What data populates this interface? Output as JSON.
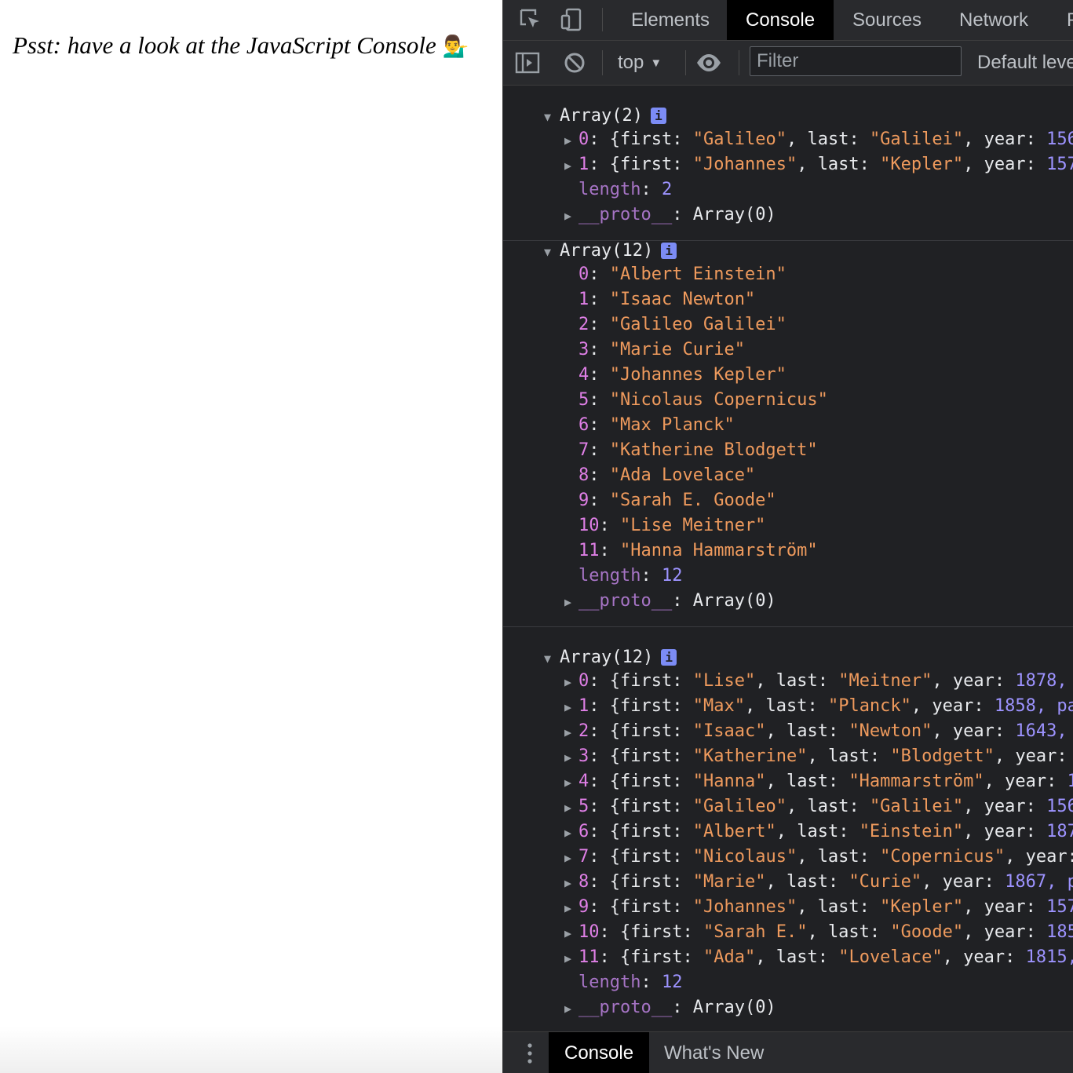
{
  "page": {
    "text": "Psst: have a look at the JavaScript Console",
    "emoji": "💁‍♂️"
  },
  "devtools": {
    "tabs": [
      "Elements",
      "Console",
      "Sources",
      "Network",
      "P"
    ],
    "active_tab": "Console",
    "toolbar": {
      "context": "top",
      "filter_placeholder": "Filter",
      "levels": "Default levels"
    },
    "drawer": {
      "tabs": [
        "Console",
        "What's New"
      ]
    },
    "icons": {
      "inspect": "inspect-element-icon",
      "device": "device-toggle-icon",
      "sidebar": "sidebar-toggle-icon",
      "clear": "clear-console-icon",
      "eye": "live-expression-icon",
      "kebab": "more-options-icon"
    },
    "colors": {
      "index": "#df7fe6",
      "string": "#ee9a5d",
      "number": "#9d93ff",
      "meta": "#a674c5"
    }
  },
  "console": {
    "messages": [
      {
        "header": "Array(2)",
        "rows": [
          {
            "kind": "obj",
            "idx": "0",
            "first": "\"Galileo\"",
            "last": "\"Galilei\"",
            "tail": "156"
          },
          {
            "kind": "obj",
            "idx": "1",
            "first": "\"Johannes\"",
            "last": "\"Kepler\"",
            "tail": "157"
          },
          {
            "kind": "len",
            "idx": "length",
            "val": "2"
          },
          {
            "kind": "proto",
            "idx": "__proto__",
            "val": "Array(0)"
          }
        ]
      },
      {
        "header": "Array(12)",
        "rows": [
          {
            "kind": "str",
            "idx": "0",
            "val": "\"Albert Einstein\""
          },
          {
            "kind": "str",
            "idx": "1",
            "val": "\"Isaac Newton\""
          },
          {
            "kind": "str",
            "idx": "2",
            "val": "\"Galileo Galilei\""
          },
          {
            "kind": "str",
            "idx": "3",
            "val": "\"Marie Curie\""
          },
          {
            "kind": "str",
            "idx": "4",
            "val": "\"Johannes Kepler\""
          },
          {
            "kind": "str",
            "idx": "5",
            "val": "\"Nicolaus Copernicus\""
          },
          {
            "kind": "str",
            "idx": "6",
            "val": "\"Max Planck\""
          },
          {
            "kind": "str",
            "idx": "7",
            "val": "\"Katherine Blodgett\""
          },
          {
            "kind": "str",
            "idx": "8",
            "val": "\"Ada Lovelace\""
          },
          {
            "kind": "str",
            "idx": "9",
            "val": "\"Sarah E. Goode\""
          },
          {
            "kind": "str",
            "idx": "10",
            "val": "\"Lise Meitner\""
          },
          {
            "kind": "str",
            "idx": "11",
            "val": "\"Hanna Hammarström\""
          },
          {
            "kind": "len",
            "idx": "length",
            "val": "12"
          },
          {
            "kind": "proto",
            "idx": "__proto__",
            "val": "Array(0)"
          }
        ]
      },
      {
        "header": "Array(12)",
        "rows": [
          {
            "kind": "obj",
            "idx": "0",
            "first": "\"Lise\"",
            "last": "\"Meitner\"",
            "tail": "1878,"
          },
          {
            "kind": "obj",
            "idx": "1",
            "first": "\"Max\"",
            "last": "\"Planck\"",
            "tail": "1858, pa"
          },
          {
            "kind": "obj",
            "idx": "2",
            "first": "\"Isaac\"",
            "last": "\"Newton\"",
            "tail": "1643,"
          },
          {
            "kind": "obj",
            "idx": "3",
            "first": "\"Katherine\"",
            "last": "\"Blodgett\"",
            "tail": ""
          },
          {
            "kind": "obj",
            "idx": "4",
            "first": "\"Hanna\"",
            "last": "\"Hammarström\"",
            "tail": "1"
          },
          {
            "kind": "obj",
            "idx": "5",
            "first": "\"Galileo\"",
            "last": "\"Galilei\"",
            "tail": "156"
          },
          {
            "kind": "obj",
            "idx": "6",
            "first": "\"Albert\"",
            "last": "\"Einstein\"",
            "tail": "187"
          },
          {
            "kind": "obj",
            "idx": "7",
            "first": "\"Nicolaus\"",
            "last": "\"Copernicus\"",
            "tail": ""
          },
          {
            "kind": "obj",
            "idx": "8",
            "first": "\"Marie\"",
            "last": "\"Curie\"",
            "tail": "1867, p"
          },
          {
            "kind": "obj",
            "idx": "9",
            "first": "\"Johannes\"",
            "last": "\"Kepler\"",
            "tail": "157"
          },
          {
            "kind": "obj",
            "idx": "10",
            "first": "\"Sarah E.\"",
            "last": "\"Goode\"",
            "tail": "185"
          },
          {
            "kind": "obj",
            "idx": "11",
            "first": "\"Ada\"",
            "last": "\"Lovelace\"",
            "tail": "1815,"
          },
          {
            "kind": "len",
            "idx": "length",
            "val": "12"
          },
          {
            "kind": "proto",
            "idx": "__proto__",
            "val": "Array(0)"
          }
        ]
      }
    ]
  }
}
